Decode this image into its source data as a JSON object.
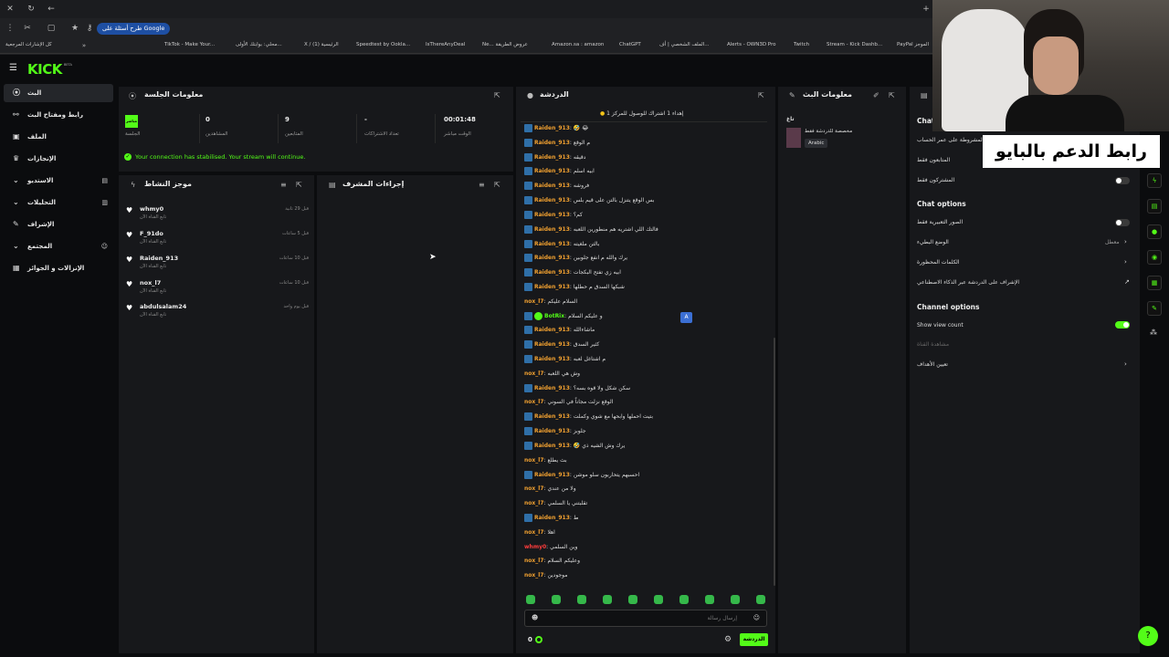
{
  "browser": {
    "tab_google_pill": "طرح أسئلة على Google",
    "bookmarks": [
      "كل الإشارات المرجعية",
      "TikTok - Make Your...",
      "محلي: بوابتك الأولى...",
      "X / (1) الرئيسية",
      "Speedtest by Ookla...",
      "IsThereAnyDeal",
      "Ne... عروض الطريقة",
      "Amazon.sa : amazon",
      "ChatGPT",
      "الملف الشخصي | أف...",
      "Alerts - OWN3D Pro",
      "Twitch",
      "Stream - Kick Dashb...",
      "PayPal الموجز"
    ]
  },
  "app": {
    "logo": "KICK",
    "logo_badge": "BETA"
  },
  "sidebar": {
    "items": [
      {
        "label": "البث",
        "icon": "radio-icon",
        "active": true,
        "chevron": false
      },
      {
        "label": "رابط ومفتاح البث",
        "icon": "link-icon",
        "active": false,
        "chevron": false
      },
      {
        "label": "الملف",
        "icon": "id-icon",
        "active": false,
        "chevron": false
      },
      {
        "label": "الإنجازات",
        "icon": "trophy-icon",
        "active": false,
        "chevron": false
      },
      {
        "label": "الاستديو",
        "icon": "studio-icon",
        "active": false,
        "chevron": true
      },
      {
        "label": "التحليلات",
        "icon": "analytics-icon",
        "active": false,
        "chevron": true
      },
      {
        "label": "الإشراف",
        "icon": "wrench-icon",
        "active": false,
        "chevron": false
      },
      {
        "label": "المجتمع",
        "icon": "community-icon",
        "active": false,
        "chevron": true
      },
      {
        "label": "الإنزالات و الجوائز",
        "icon": "gift-icon",
        "active": false,
        "chevron": false
      }
    ]
  },
  "session": {
    "title": "معلومات الجلسة",
    "live_badge": "مباشر",
    "live_label": "الجلسة",
    "stats": [
      {
        "value": "0",
        "label": "المشاهدين"
      },
      {
        "value": "9",
        "label": "المتابعين"
      },
      {
        "value": "-",
        "label": "تعداد الاشتراكات"
      },
      {
        "value": "00:01:48",
        "label": "الوقت مباشر"
      }
    ],
    "notice": "Your connection has stabilised. Your stream will continue."
  },
  "activity": {
    "title": "موجز النشاط",
    "items": [
      {
        "name": "whmy0",
        "sub": "تابع القناة الآن",
        "time": "قبل 29 ثانية"
      },
      {
        "name": "F_91do",
        "sub": "تابع القناة الآن",
        "time": "قبل 5 ساعات"
      },
      {
        "name": "Raiden_913",
        "sub": "تابع القناة الآن",
        "time": "قبل 10 ساعات"
      },
      {
        "name": "nox_l7",
        "sub": "تابع القناة الآن",
        "time": "قبل 10 ساعات"
      },
      {
        "name": "abdulsalam24",
        "sub": "تابع القناة الآن",
        "time": "قبل يوم واحد"
      }
    ]
  },
  "modactions": {
    "title": "إجراءات المشرف"
  },
  "chat": {
    "title": "الدردشة",
    "pinned": "إهداء 1 اشتراك للوصول للمركز 1",
    "messages": [
      {
        "user": "Raiden_913",
        "badge": "kick",
        "color": "orange",
        "text": "🤣 😂"
      },
      {
        "user": "Raiden_913",
        "badge": "kick",
        "color": "orange",
        "text": "م الوقع"
      },
      {
        "user": "Raiden_913",
        "badge": "kick",
        "color": "orange",
        "text": "دقيقه"
      },
      {
        "user": "Raiden_913",
        "badge": "kick",
        "color": "orange",
        "text": "ابيه اسلم"
      },
      {
        "user": "Raiden_913",
        "badge": "kick",
        "color": "orange",
        "text": "فروشه"
      },
      {
        "user": "Raiden_913",
        "badge": "kick",
        "color": "orange",
        "text": "بس الوقع يتنزل بالتن على قيم بلس"
      },
      {
        "user": "Raiden_913",
        "badge": "kick",
        "color": "orange",
        "text": "كم؟"
      },
      {
        "user": "Raiden_913",
        "badge": "kick",
        "color": "orange",
        "text": "فالتك اللي اشتريه هم منطورين اللعبه"
      },
      {
        "user": "Raiden_913",
        "badge": "kick",
        "color": "orange",
        "text": "بالتن ملغيته"
      },
      {
        "user": "Raiden_913",
        "badge": "kick",
        "color": "orange",
        "text": "يرك والله م انفع جلوبين"
      },
      {
        "user": "Raiden_913",
        "badge": "kick",
        "color": "orange",
        "text": "ابيه زي تفتح البكجات"
      },
      {
        "user": "Raiden_913",
        "badge": "kick",
        "color": "orange",
        "text": "شبكها السدق م حطلها"
      },
      {
        "user": "nox_l7",
        "badge": "",
        "color": "orange",
        "text": "السلام عليكم"
      },
      {
        "user": "BotRix",
        "badge": "bot",
        "color": "green",
        "text": "و عليكم السلام"
      },
      {
        "user": "Raiden_913",
        "badge": "kick",
        "color": "orange",
        "text": "ماشاءالله"
      },
      {
        "user": "Raiden_913",
        "badge": "kick",
        "color": "orange",
        "text": "كثير السدق"
      },
      {
        "user": "Raiden_913",
        "badge": "kick",
        "color": "orange",
        "text": "م اشتاغل لعبه"
      },
      {
        "user": "nox_l7",
        "badge": "",
        "color": "orange",
        "text": "وش هي اللعبه"
      },
      {
        "user": "Raiden_913",
        "badge": "kick",
        "color": "orange",
        "text": "سكن شكل ولا قوه بسه؟"
      },
      {
        "user": "nox_l7",
        "badge": "",
        "color": "orange",
        "text": "الوقع نزلت مجاناً في السوني"
      },
      {
        "user": "Raiden_913",
        "badge": "kick",
        "color": "orange",
        "text": "بتيت احملها وابحها مع شوي وكملت"
      },
      {
        "user": "Raiden_913",
        "badge": "kick",
        "color": "orange",
        "text": "جلوبز"
      },
      {
        "user": "Raiden_913",
        "badge": "kick",
        "color": "orange",
        "text": "🤣 يرك وش الشيه ذي"
      },
      {
        "user": "nox_l7",
        "badge": "",
        "color": "orange",
        "text": "بث يطلع"
      },
      {
        "user": "Raiden_913",
        "badge": "kick",
        "color": "orange",
        "text": "احسبهم يتحاربون سلو موشن"
      },
      {
        "user": "nox_l7",
        "badge": "",
        "color": "orange",
        "text": "ولا من عندي"
      },
      {
        "user": "nox_l7",
        "badge": "",
        "color": "orange",
        "text": "تقلبتني يا السلمي"
      },
      {
        "user": "Raiden_913",
        "badge": "kick",
        "color": "orange",
        "text": "ط"
      },
      {
        "user": "nox_l7",
        "badge": "",
        "color": "orange",
        "text": "اهلا"
      },
      {
        "user": "whmy0",
        "badge": "",
        "color": "red",
        "text": "وين السلمي"
      },
      {
        "user": "nox_l7",
        "badge": "",
        "color": "orange",
        "text": "وعليكم السلام"
      },
      {
        "user": "nox_l7",
        "badge": "",
        "color": "orange",
        "text": "موجودين"
      }
    ],
    "input_placeholder": "إرسال رسالة",
    "viewer_count": "0",
    "send_label": "الدردشة"
  },
  "streaminfo": {
    "title": "معلومات البث",
    "category_label": "تاغ",
    "category_name": "مخصصة للدردشة فقط",
    "tag": "Arabic"
  },
  "settings": {
    "chat_title": "Chat",
    "rows_top": [
      {
        "label": "المشروطة على عمر الحساب",
        "type": "text"
      },
      {
        "label": "المتابعون فقط",
        "type": "text"
      },
      {
        "label": "المشتركون فقط",
        "type": "toggle",
        "on": false
      }
    ],
    "chat_options_title": "Chat options",
    "options": [
      {
        "label": "الصور التعبيرية فقط",
        "type": "toggle",
        "on": false
      },
      {
        "label": "الوضع البطيء",
        "type": "chevron",
        "value": "معطل"
      },
      {
        "label": "الكلمات المحظورة",
        "type": "chevron",
        "value": ""
      },
      {
        "label": "الإشراف على الدردشة عبر الذكاء الاصطناعي",
        "type": "link",
        "value": ""
      }
    ],
    "channel_options_title": "Channel options",
    "show_view_count_label": "Show view count",
    "show_view_count_on": true,
    "faded_label": "مشاهدة القناة",
    "goals_label": "تعيين الأهداف"
  },
  "overlay": {
    "text": "رابط الدعم بالبايو"
  },
  "colors": {
    "accent": "#53fc18",
    "panel": "#17181b",
    "bg": "#0b0c0e"
  }
}
